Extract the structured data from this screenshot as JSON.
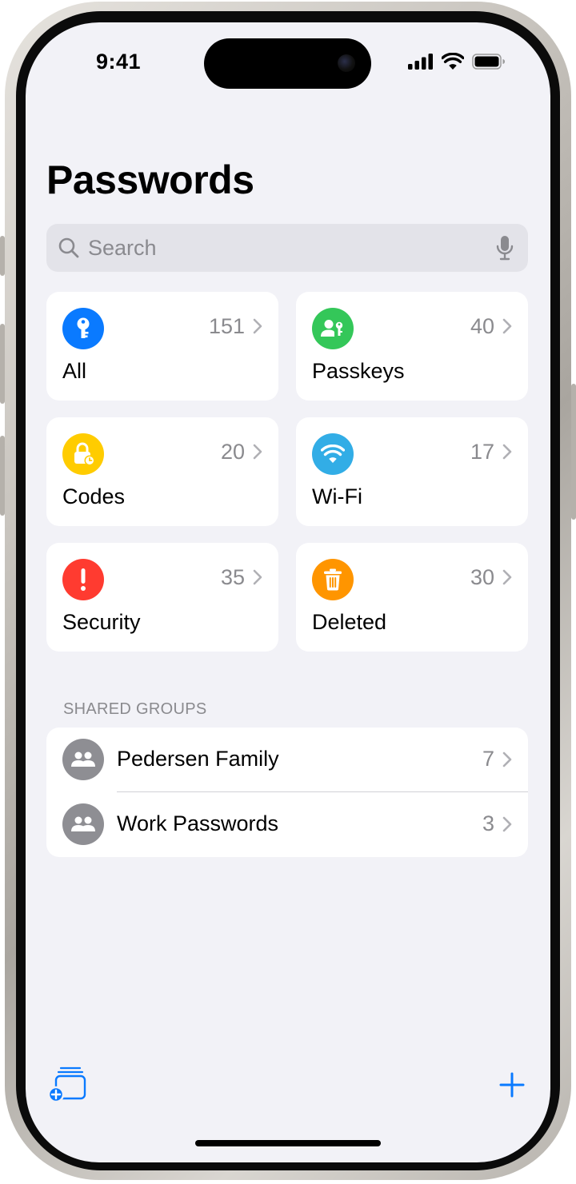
{
  "status": {
    "time": "9:41"
  },
  "page": {
    "title": "Passwords"
  },
  "search": {
    "placeholder": "Search"
  },
  "categories": [
    {
      "label": "All",
      "count": "151",
      "icon": "key-icon",
      "color": "#0a7aff"
    },
    {
      "label": "Passkeys",
      "count": "40",
      "icon": "person-key-icon",
      "color": "#34c759"
    },
    {
      "label": "Codes",
      "count": "20",
      "icon": "lock-clock-icon",
      "color": "#ffcc00"
    },
    {
      "label": "Wi-Fi",
      "count": "17",
      "icon": "wifi-icon",
      "color": "#32ade6"
    },
    {
      "label": "Security",
      "count": "35",
      "icon": "exclamation-icon",
      "color": "#ff3b30"
    },
    {
      "label": "Deleted",
      "count": "30",
      "icon": "trash-icon",
      "color": "#ff9500"
    }
  ],
  "shared_groups": {
    "header": "SHARED GROUPS",
    "items": [
      {
        "name": "Pedersen Family",
        "count": "7",
        "icon": "people-icon"
      },
      {
        "name": "Work Passwords",
        "count": "3",
        "icon": "people-icon"
      }
    ]
  },
  "toolbar": {
    "left_icon": "new-group-icon",
    "right_icon": "plus-icon",
    "accent": "#0a7aff"
  }
}
